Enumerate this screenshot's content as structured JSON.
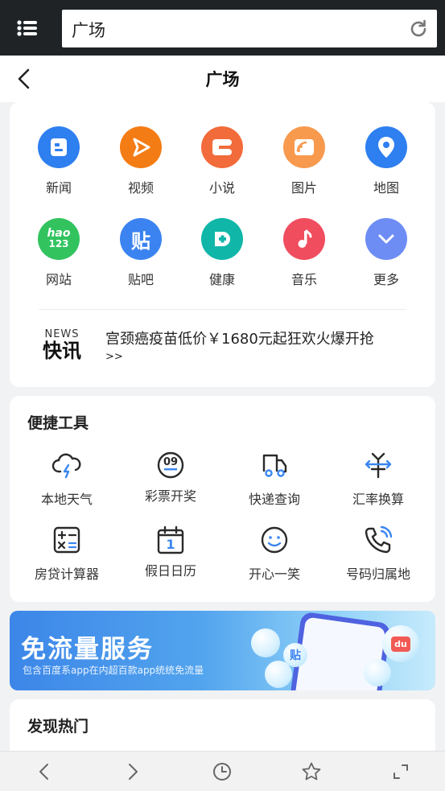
{
  "browser": {
    "url_text": "广场"
  },
  "header": {
    "title": "广场"
  },
  "apps": [
    {
      "label": "新闻",
      "icon": "news-icon",
      "color": "#2e7ff0"
    },
    {
      "label": "视频",
      "icon": "video-play-icon",
      "color": "#f47c14"
    },
    {
      "label": "小说",
      "icon": "novel-icon",
      "color": "#f26b3a"
    },
    {
      "label": "图片",
      "icon": "image-icon",
      "color": "#f79a4e"
    },
    {
      "label": "地图",
      "icon": "map-pin-icon",
      "color": "#2e7ff0"
    },
    {
      "label": "网站",
      "icon": "hao123-icon",
      "color": "#32c35f",
      "icon_text_top": "hao",
      "icon_text_bottom": "123"
    },
    {
      "label": "贴吧",
      "icon": "tieba-icon",
      "color": "#3b83f0",
      "icon_text": "贴"
    },
    {
      "label": "健康",
      "icon": "health-icon",
      "color": "#10b6a8"
    },
    {
      "label": "音乐",
      "icon": "music-note-icon",
      "color": "#f04d5f"
    },
    {
      "label": "更多",
      "icon": "chevron-down-icon",
      "color": "#6d8df5"
    }
  ],
  "news": {
    "tag_en": "NEWS",
    "tag_cn": "快讯",
    "headline": "宫颈癌疫苗低价￥1680元起狂欢火爆开抢",
    "more": ">>"
  },
  "tools": {
    "title": "便捷工具",
    "items": [
      {
        "label": "本地天气",
        "icon": "weather-cloud-icon"
      },
      {
        "label": "彩票开奖",
        "icon": "lottery-ball-icon",
        "icon_text": "09"
      },
      {
        "label": "快递查询",
        "icon": "delivery-truck-icon"
      },
      {
        "label": "汇率换算",
        "icon": "currency-exchange-icon"
      },
      {
        "label": "房贷计算器",
        "icon": "calculator-icon"
      },
      {
        "label": "假日日历",
        "icon": "calendar-icon",
        "icon_text": "1"
      },
      {
        "label": "开心一笑",
        "icon": "smiley-icon"
      },
      {
        "label": "号码归属地",
        "icon": "phone-call-icon"
      }
    ]
  },
  "banner": {
    "title": "免流量服务",
    "subtitle": "包含百度系app在内超百款app统统免流量",
    "badge_tieba": "贴",
    "badge_du": "du"
  },
  "discover": {
    "title": "发现热门"
  },
  "bottom_nav": [
    "back-icon",
    "forward-icon",
    "history-clock-icon",
    "star-bookmark-icon",
    "fullscreen-icon"
  ]
}
